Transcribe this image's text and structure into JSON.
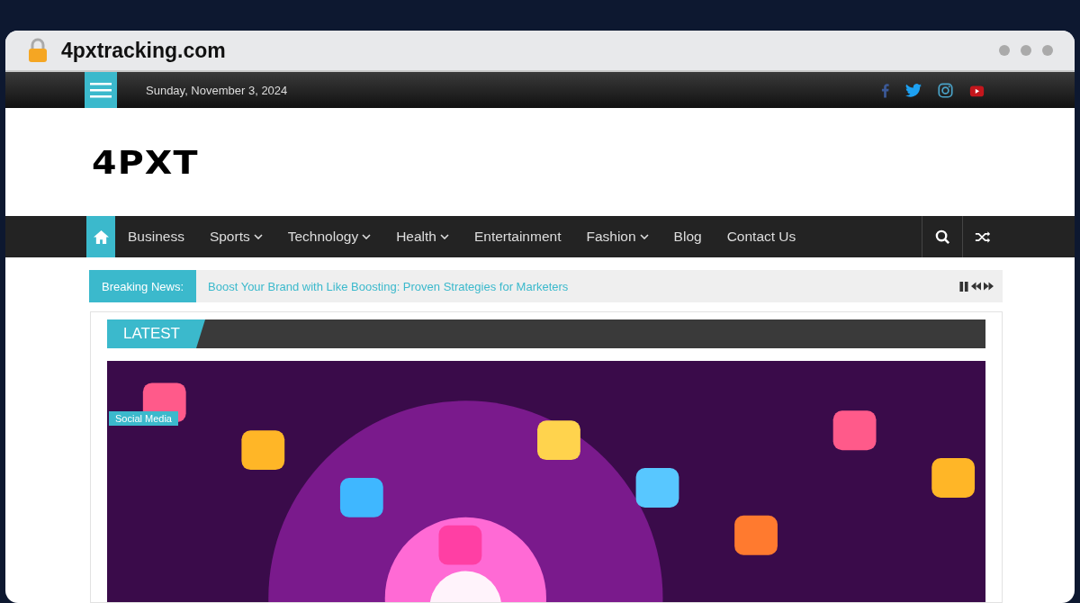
{
  "browser": {
    "address": "4pxtracking.com"
  },
  "top_bar": {
    "date": "Sunday, November 3, 2024"
  },
  "logo": "4PXT",
  "nav": {
    "items": [
      {
        "kind": "home",
        "selected": true
      },
      {
        "kind": "link",
        "label": "Business",
        "dropdown": false,
        "selected": false
      },
      {
        "kind": "link",
        "label": "Sports",
        "dropdown": true,
        "selected": false
      },
      {
        "kind": "link",
        "label": "Technology",
        "dropdown": true,
        "selected": false
      },
      {
        "kind": "link",
        "label": "Health",
        "dropdown": true,
        "selected": false
      },
      {
        "kind": "link",
        "label": "Entertainment",
        "dropdown": false,
        "selected": false
      },
      {
        "kind": "link",
        "label": "Fashion",
        "dropdown": true,
        "selected": false
      },
      {
        "kind": "link",
        "label": "Blog",
        "dropdown": false,
        "selected": false
      },
      {
        "kind": "link",
        "label": "Contact Us",
        "dropdown": false,
        "selected": false
      }
    ]
  },
  "breaking_news": {
    "label": "Breaking News:",
    "headline": "Boost Your Brand with Like Boosting: Proven Strategies for Marketers"
  },
  "latest": {
    "title": "LATEST",
    "featured": {
      "kind": "picture",
      "category": "Social Media"
    }
  }
}
